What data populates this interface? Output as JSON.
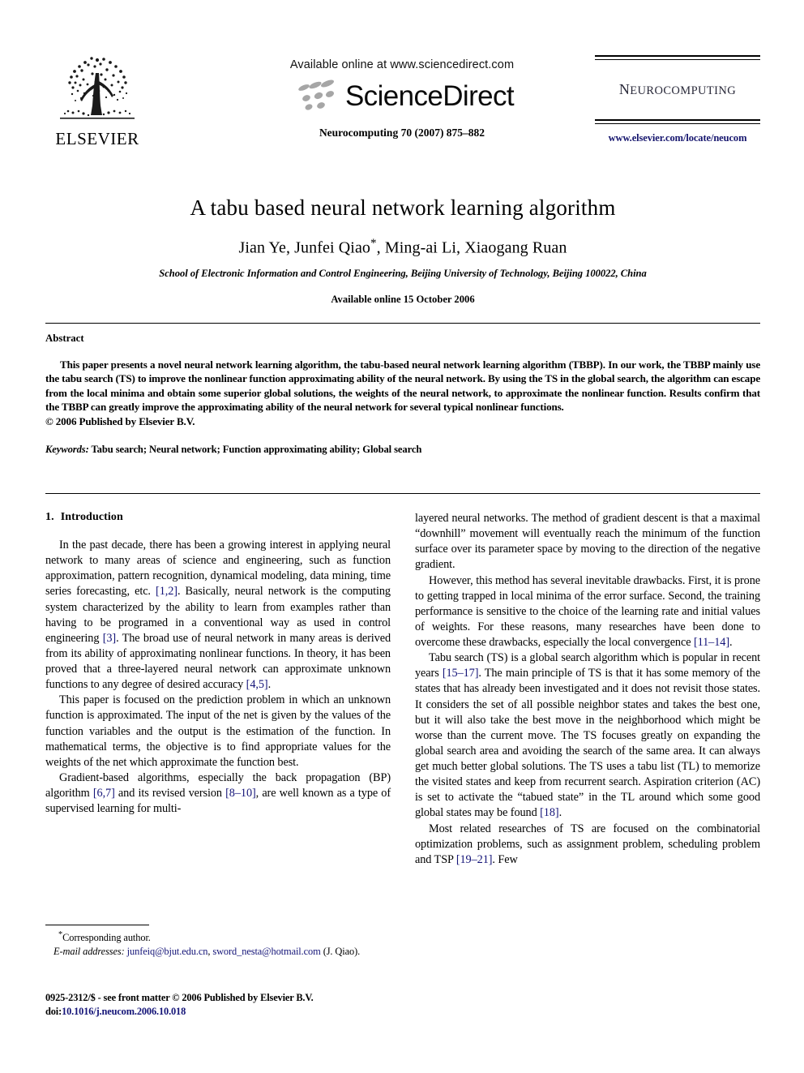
{
  "header": {
    "publisher_logo_name": "elsevier-tree-logo",
    "publisher_name": "ELSEVIER",
    "available_online_at": "Available online at www.sciencedirect.com",
    "sciencedirect_wordmark": "ScienceDirect",
    "journal_citation": "Neurocomputing 70 (2007) 875–882",
    "journal_brand_first_letter": "N",
    "journal_brand_rest": "EUROCOMPUTING",
    "journal_url": "www.elsevier.com/locate/neucom"
  },
  "title_block": {
    "title": "A tabu based neural network learning algorithm",
    "authors_pre": "Jian Ye, Junfei Qiao",
    "authors_star": "*",
    "authors_post": ", Ming-ai Li, Xiaogang Ruan",
    "affiliation": "School of Electronic Information and Control Engineering, Beijing University of Technology, Beijing 100022, China",
    "available_date": "Available online 15 October 2006"
  },
  "abstract": {
    "heading": "Abstract",
    "body": "This paper presents a novel neural network learning algorithm, the tabu-based neural network learning algorithm (TBBP). In our work, the TBBP mainly use the tabu search (TS) to improve the nonlinear function approximating ability of the neural network. By using the TS in the global search, the algorithm can escape from the local minima and obtain some superior global solutions, the weights of the neural network, to approximate the nonlinear function. Results confirm that the TBBP can greatly improve the approximating ability of the neural network for several typical nonlinear functions.",
    "copyright": "© 2006 Published by Elsevier B.V.",
    "keywords_label": "Keywords:",
    "keywords_value": "Tabu search; Neural network; Function approximating ability; Global search"
  },
  "introduction": {
    "section_number": "1.",
    "section_title": "Introduction",
    "left_paragraphs": [
      {
        "id": "p1",
        "parts": [
          {
            "t": "In the past decade, there has been a growing interest in applying neural network to many areas of science and engineering, such as function approximation, pattern recognition, dynamical modeling, data mining, time series forecasting, etc. ",
            "cite": false
          },
          {
            "t": "[1,2]",
            "cite": true
          },
          {
            "t": ". Basically, neural network is the computing system characterized by the ability to learn from examples rather than having to be programed in a conventional way as used in control engineering ",
            "cite": false
          },
          {
            "t": "[3]",
            "cite": true
          },
          {
            "t": ". The broad use of neural network in many areas is derived from its ability of approximating nonlinear functions. In theory, it has been proved that a three-layered neural network can approximate unknown functions to any degree of desired accuracy ",
            "cite": false
          },
          {
            "t": "[4,5]",
            "cite": true
          },
          {
            "t": ".",
            "cite": false
          }
        ]
      },
      {
        "id": "p2",
        "parts": [
          {
            "t": "This paper is focused on the prediction problem in which an unknown function is approximated. The input of the net is given by the values of the function variables and the output is the estimation of the function. In mathematical terms, the objective is to find appropriate values for the weights of the net which approximate the function best.",
            "cite": false
          }
        ]
      },
      {
        "id": "p3",
        "parts": [
          {
            "t": "Gradient-based algorithms, especially the back propagation (BP) algorithm ",
            "cite": false
          },
          {
            "t": "[6,7]",
            "cite": true
          },
          {
            "t": " and its revised version ",
            "cite": false
          },
          {
            "t": "[8–10]",
            "cite": true
          },
          {
            "t": ", are well known as a type of supervised learning for multi-",
            "cite": false
          }
        ]
      }
    ],
    "right_paragraphs": [
      {
        "id": "p4",
        "continued": true,
        "parts": [
          {
            "t": "layered neural networks. The method of gradient descent is that a maximal “downhill” movement will eventually reach the minimum of the function surface over its parameter space by moving to the direction of the negative gradient.",
            "cite": false
          }
        ]
      },
      {
        "id": "p5",
        "parts": [
          {
            "t": "However, this method has several inevitable drawbacks. First, it is prone to getting trapped in local minima of the error surface. Second, the training performance is sensitive to the choice of the learning rate and initial values of weights. For these reasons, many researches have been done to overcome these drawbacks, especially the local convergence ",
            "cite": false
          },
          {
            "t": "[11–14]",
            "cite": true
          },
          {
            "t": ".",
            "cite": false
          }
        ]
      },
      {
        "id": "p6",
        "parts": [
          {
            "t": "Tabu search (TS) is a global search algorithm which is popular in recent years ",
            "cite": false
          },
          {
            "t": "[15–17]",
            "cite": true
          },
          {
            "t": ". The main principle of TS is that it has some memory of the states that has already been investigated and it does not revisit those states. It considers the set of all possible neighbor states and takes the best one, but it will also take the best move in the neighborhood which might be worse than the current move. The TS focuses greatly on expanding the global search area and avoiding the search of the same area. It can always get much better global solutions. The TS uses a tabu list (TL) to memorize the visited states and keep from recurrent search. Aspiration criterion (AC) is set to activate the “tabued state” in the TL around which some good global states may be found ",
            "cite": false
          },
          {
            "t": "[18]",
            "cite": true
          },
          {
            "t": ".",
            "cite": false
          }
        ]
      },
      {
        "id": "p7",
        "parts": [
          {
            "t": "Most related researches of TS are focused on the combinatorial optimization problems, such as assignment problem, scheduling problem and TSP ",
            "cite": false
          },
          {
            "t": "[19–21]",
            "cite": true
          },
          {
            "t": ". Few",
            "cite": false
          }
        ]
      }
    ]
  },
  "footnote": {
    "corresponding_star": "*",
    "corresponding_text": "Corresponding author.",
    "email_label": "E-mail addresses:",
    "email_1": "junfeiq@bjut.edu.cn",
    "email_sep": ", ",
    "email_2": "sword_nesta@hotmail.com",
    "email_attrib": "(J. Qiao)."
  },
  "imprint": {
    "issn_line": "0925-2312/$ - see front matter © 2006 Published by Elsevier B.V.",
    "doi_label": "doi:",
    "doi_value": "10.1016/j.neucom.2006.10.018"
  },
  "colors": {
    "link": "#141478",
    "text": "#000000",
    "brand_gray": "#2a2a3a",
    "sd_dot_gray": "#9a9a9a"
  }
}
